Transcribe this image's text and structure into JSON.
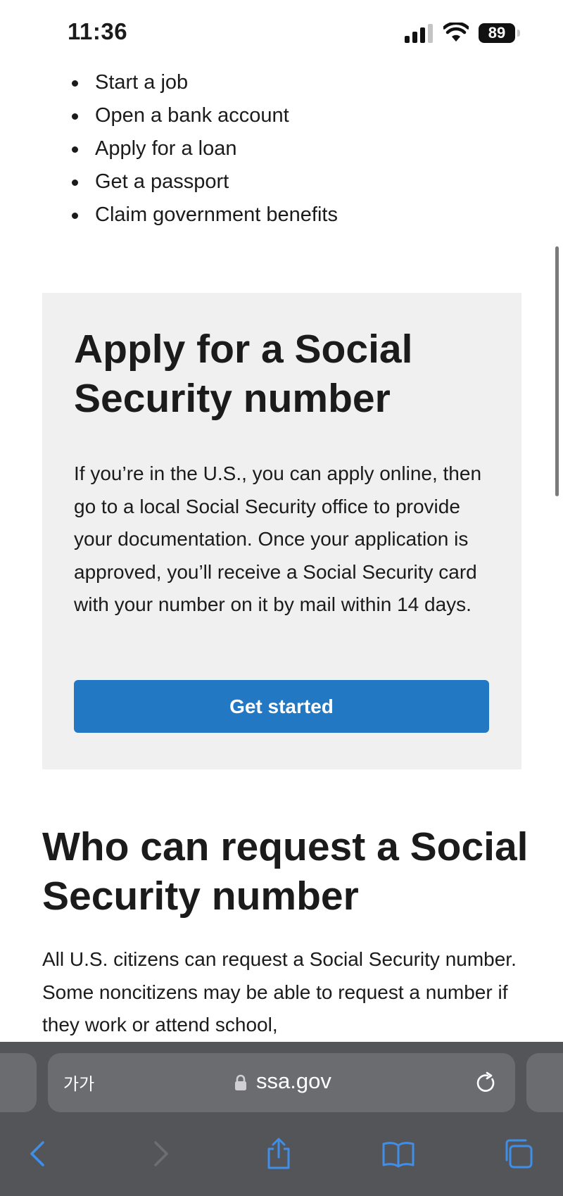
{
  "status_bar": {
    "time": "11:36",
    "battery": "89"
  },
  "bullets": [
    "Start a job",
    "Open a bank account",
    "Apply for a loan",
    "Get a passport",
    "Claim government benefits"
  ],
  "apply_section": {
    "title": "Apply for a Social Security number",
    "body": "If you’re in the U.S., you can apply online, then go to a local Social Security office to provide your documentation. Once your application is approved, you’ll receive a Social Security card with your number on it by mail within 14 days.",
    "button_label": "Get started"
  },
  "who_section": {
    "title": "Who can request a Social Security number",
    "body": "All U.S. citizens can request a Social Security number. Some noncitizens may be able to request a number if they work or attend school,"
  },
  "browser": {
    "text_size_label": "가가",
    "domain": "ssa.gov",
    "toolbar_icons": [
      "back-icon",
      "forward-icon",
      "share-icon",
      "bookmarks-icon",
      "tabs-icon"
    ]
  },
  "colors": {
    "button": "#2378c3",
    "panel": "#f0f0f0",
    "toolbar_accent": "#3f8ee8",
    "chrome_background": "#545558"
  }
}
